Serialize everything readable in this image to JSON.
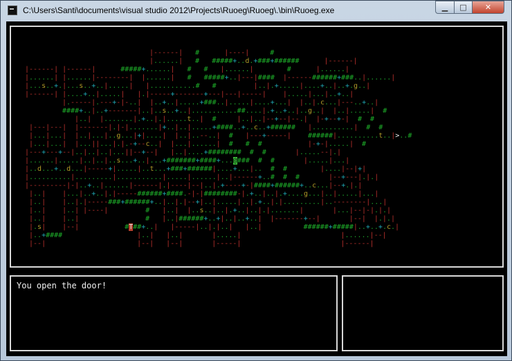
{
  "window": {
    "title": "C:\\Users\\Santi\\documents\\visual studio 2012\\Projects\\Ruoeg\\Ruoeg\\.\\bin\\Ruoeg.exe",
    "minimize": "▁",
    "maximize": "□",
    "close": "✕"
  },
  "legend": {
    "wall": "|-",
    "floor": ".",
    "door": "+",
    "corridor": "#",
    "player": "@",
    "stairs": ">",
    "trap": "T"
  },
  "colors": {
    "wall": "#b8302c",
    "floor": "#1c9e2a",
    "door": "#1fa8b4",
    "corridor": "#1eb02a",
    "monster": "#b09a28",
    "player_bg": "#3bc23b"
  },
  "map": [
    "                              |------|   #      |----|     #               ",
    "                              |......|   #   #####+..d.+###+######      |------| ",
    "|------| |------|      #####+......|   #   #   |......|        #      |......| ",
    "|......| |......|--------|  |......|   #   #####+..|---|####  |------######+###..|......| ",
    "|...s..+.|...s..+..|.....|   |...........#   #         |..|.+.....|....+..|..+.g..| ",
    "|------| |....+..|.....|   |.|-----+-------+---|---|-----|    |.....|...|..+..| ",
    "         |.-----|.---+-|-..|  |..+..|.....+###..|.....|....+...|  |..|.c...|---..+..| ",
    "         ####+..|..+-------|..|..s..+..|...........##....|.+..+..|..g..|  |..|.....|  #  ",
    "            |..|  |.......|.+..|.|.....t..|  #     |..|..|--+--|--.|  |-+--+-|  #  # ",
    " |---|---|  |-------|.|-|.......|+..|..|.....+####..+..c..+######   |..........|  #  # ",
    " |...|...|  |..|...|..g...|+|....|  |..|..--..|  #   |---+-----|    ######|..........t..|>..#  ",
    " |...|...|  |...||...|.|.-+--c..|  |...|......|  #   #  #           |-+-|.....|  #    ",
    "|---+---+--|..|..|..|...||--+--|   |..|....+########  #  #       |.....--|.| ",
    "|......|.....|..|..|..s...+..|...+#######+####+...@###  #  #       |.....|...| ",
    "|..d...+..d...|-----+|.....|..t...+###+######|....+...|..  #  #        |....|--|+| ",
    "|..........|.........|...........|.....|......|..|------+..#  #  #       |--+---|.|.| ",
    "|---------|-|..+..|......|------|.|----|--|..|.+----+-|####+######+..c...|--+.|.| ",
    " |..|    |...|..+..|.|-----######+####.-|-|########-|.+..|..|.+....g...|..|.....|...| ",
    " |..|    |..|.|-----###+######+..|..|.|--+|..|.....|..|.+..|.|.........|..--------|...| ",
    " |..|    |..| |----|         #   |..|  |..s..|..|.+..|..|.|.......|       |...|--|-|.|.| ",
    " |..|    |..|                #   |..|######+..+|..|..+..|  |-------+--|       |--|  |.|.| ",
    " |.s|    |--|           #T##+..|   |-----|..|.|..|   |..|          ######+#####|..+..+.c.| ",
    " |..+####                  |..|   |..|       |.....|                        |......|--|  ",
    " |--|                      |--|   |--|       |-----|                        |------|     "
  ],
  "message": {
    "text": "You open the door!"
  },
  "side_panel": {}
}
